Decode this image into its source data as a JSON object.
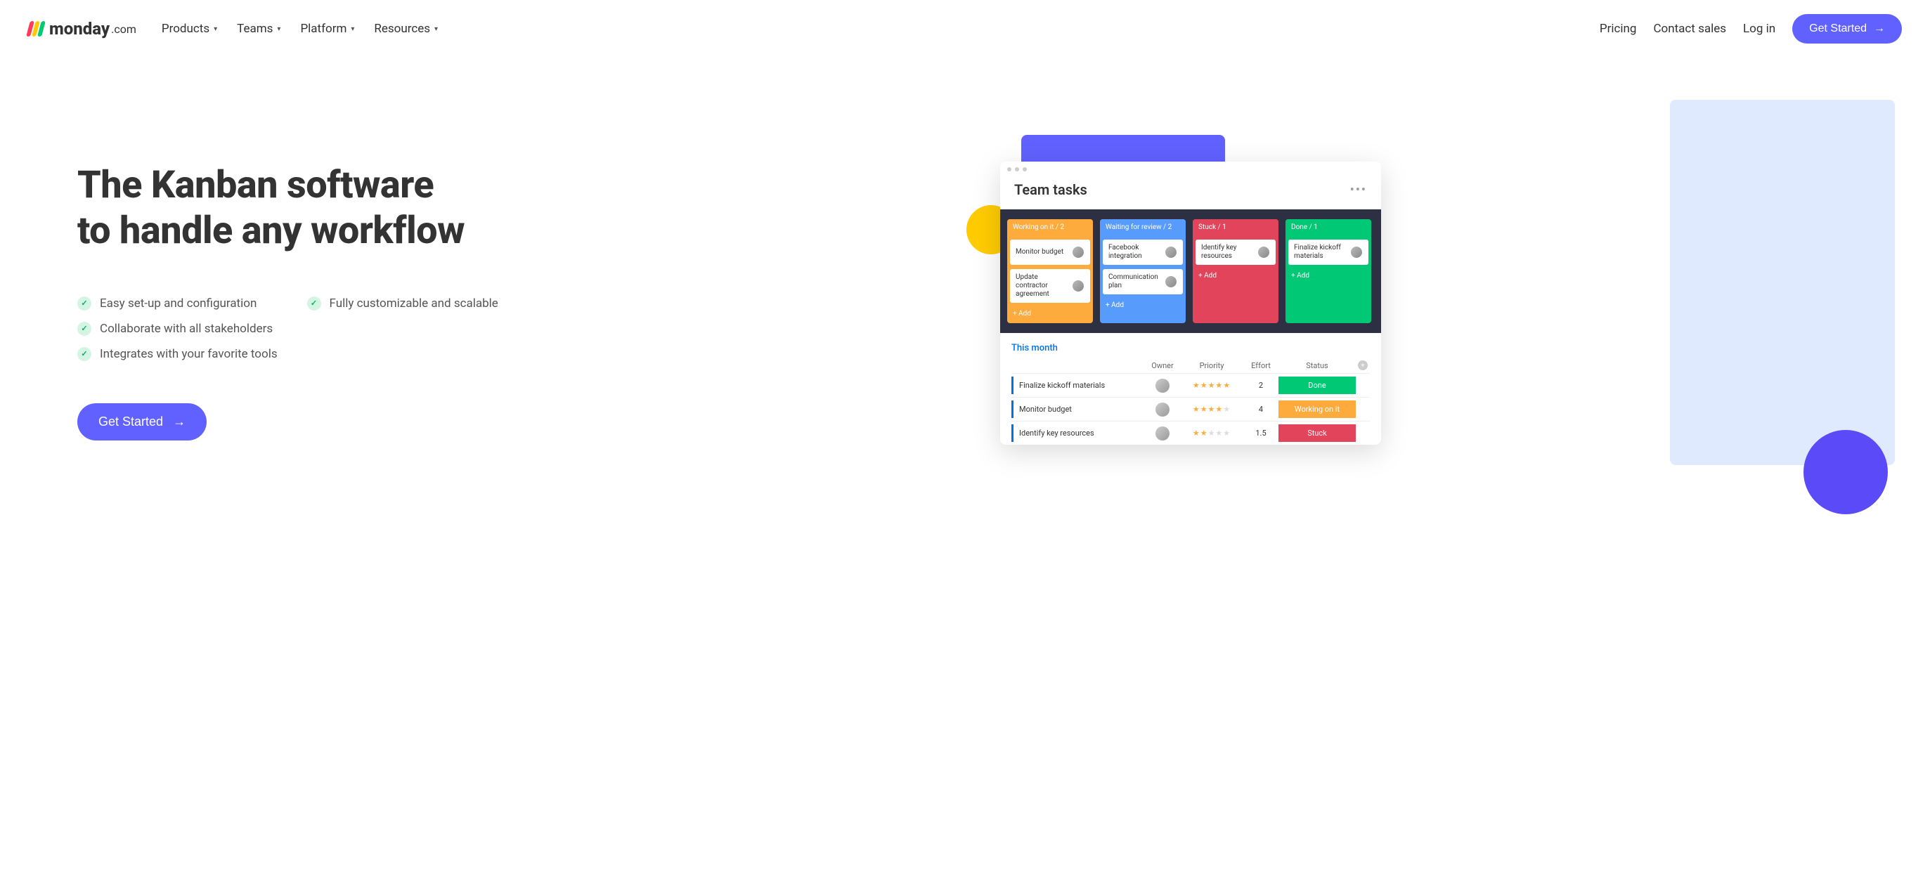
{
  "header": {
    "logo_text": "monday",
    "logo_suffix": ".com",
    "nav": [
      "Products",
      "Teams",
      "Platform",
      "Resources"
    ],
    "links": [
      "Pricing",
      "Contact sales",
      "Log in"
    ],
    "cta": "Get Started"
  },
  "hero": {
    "title_line1": "The Kanban software",
    "title_line2": "to handle any workflow",
    "features": [
      "Easy set-up and configuration",
      "Fully customizable and scalable",
      "Collaborate with all stakeholders",
      "Integrates with your favorite tools"
    ],
    "cta": "Get Started"
  },
  "panel": {
    "title": "Team tasks",
    "kanban": [
      {
        "title": "Working on it / 2",
        "color": "orange",
        "cards": [
          "Monitor budget",
          "Update contractor agreement"
        ],
        "add": "+ Add"
      },
      {
        "title": "Waiting for review / 2",
        "color": "blue",
        "cards": [
          "Facebook integration",
          "Communication plan"
        ],
        "add": "+ Add"
      },
      {
        "title": "Stuck / 1",
        "color": "red",
        "cards": [
          "Identify key resources"
        ],
        "add": "+ Add"
      },
      {
        "title": "Done / 1",
        "color": "green",
        "cards": [
          "Finalize kickoff materials"
        ],
        "add": "+ Add"
      }
    ],
    "table": {
      "section": "This month",
      "columns": [
        "Owner",
        "Priority",
        "Effort",
        "Status"
      ],
      "rows": [
        {
          "task": "Finalize kickoff materials",
          "stars": 5,
          "effort": "2",
          "status": "Done",
          "status_class": "done"
        },
        {
          "task": "Monitor budget",
          "stars": 4,
          "effort": "4",
          "status": "Working on it",
          "status_class": "working"
        },
        {
          "task": "Identify key resources",
          "stars": 2,
          "effort": "1.5",
          "status": "Stuck",
          "status_class": "stuck"
        }
      ]
    }
  }
}
